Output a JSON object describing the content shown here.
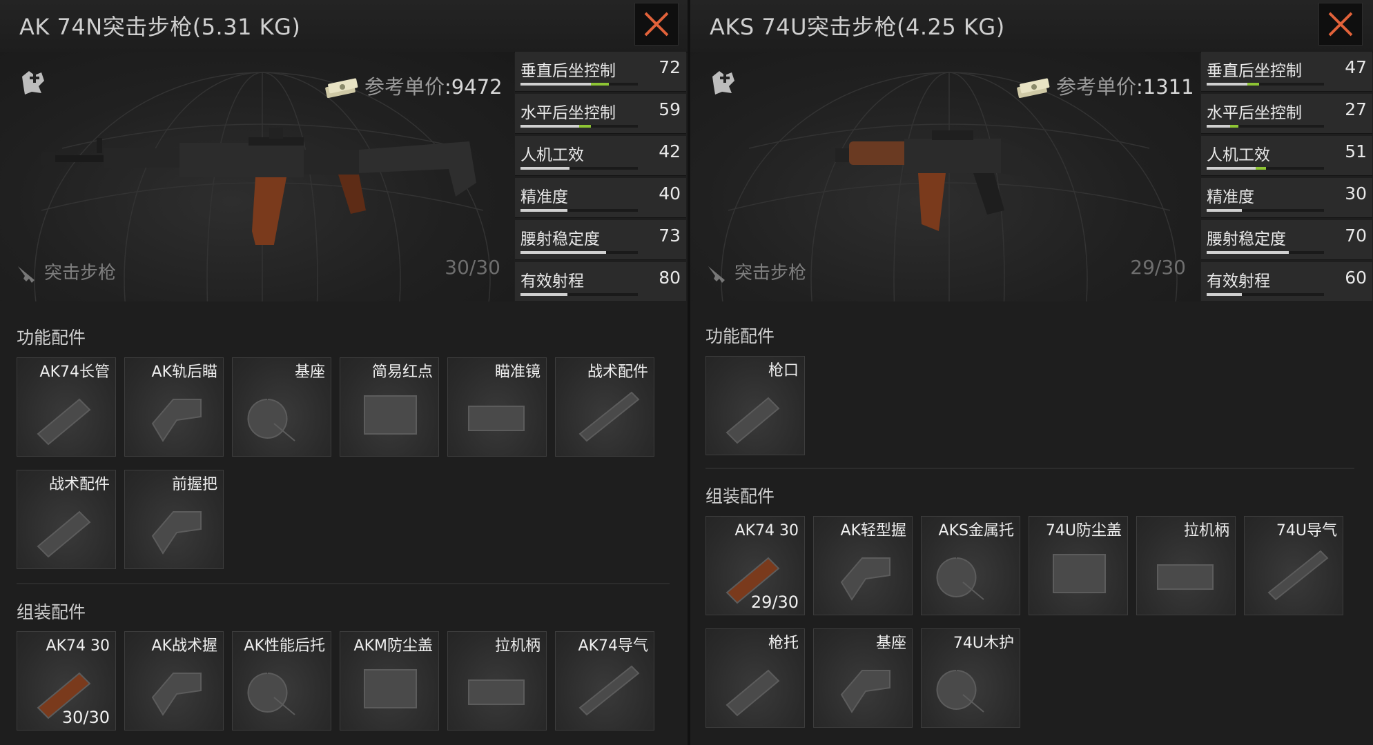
{
  "left": {
    "title": "AK 74N突击步枪(5.31 KG)",
    "price_label": "参考单价",
    "price_value": ":9472",
    "weapon_type": "突击步枪",
    "ammo": "30/30",
    "stats": [
      {
        "label": "垂直后坐控制",
        "value": "72",
        "fill": 0.6,
        "accent": 0.75
      },
      {
        "label": "水平后坐控制",
        "value": "59",
        "fill": 0.5,
        "accent": 0.6
      },
      {
        "label": "人机工效",
        "value": "42",
        "fill": 0.42,
        "accent": 0
      },
      {
        "label": "精准度",
        "value": "40",
        "fill": 0.4,
        "accent": 0
      },
      {
        "label": "腰射稳定度",
        "value": "73",
        "fill": 0.73,
        "accent": 0
      },
      {
        "label": "有效射程",
        "value": "80",
        "fill": 0.4,
        "accent": 0
      }
    ],
    "functional_title": "功能配件",
    "functional": [
      "AK74长管",
      "AK轨后瞄",
      "基座",
      "简易红点",
      "瞄准镜",
      "战术配件",
      "战术配件",
      "前握把"
    ],
    "assembly_title": "组装配件",
    "assembly": [
      {
        "label": "AK74 30",
        "ammo": "30/30"
      },
      {
        "label": "AK战术握",
        "ammo": ""
      },
      {
        "label": "AK性能后托",
        "ammo": ""
      },
      {
        "label": "AKM防尘盖",
        "ammo": ""
      },
      {
        "label": "拉机柄",
        "ammo": ""
      },
      {
        "label": "AK74导气",
        "ammo": ""
      }
    ]
  },
  "right": {
    "title": "AKS 74U突击步枪(4.25 KG)",
    "price_label": "参考单价",
    "price_value": ":1311",
    "weapon_type": "突击步枪",
    "ammo": "29/30",
    "stats": [
      {
        "label": "垂直后坐控制",
        "value": "47",
        "fill": 0.35,
        "accent": 0.45
      },
      {
        "label": "水平后坐控制",
        "value": "27",
        "fill": 0.2,
        "accent": 0.27
      },
      {
        "label": "人机工效",
        "value": "51",
        "fill": 0.42,
        "accent": 0.51
      },
      {
        "label": "精准度",
        "value": "30",
        "fill": 0.3,
        "accent": 0
      },
      {
        "label": "腰射稳定度",
        "value": "70",
        "fill": 0.7,
        "accent": 0
      },
      {
        "label": "有效射程",
        "value": "60",
        "fill": 0.3,
        "accent": 0
      }
    ],
    "functional_title": "功能配件",
    "functional": [
      "枪口"
    ],
    "assembly_title": "组装配件",
    "assembly": [
      {
        "label": "AK74 30",
        "ammo": "29/30"
      },
      {
        "label": "AK轻型握",
        "ammo": ""
      },
      {
        "label": "AKS金属托",
        "ammo": ""
      },
      {
        "label": "74U防尘盖",
        "ammo": ""
      },
      {
        "label": "拉机柄",
        "ammo": ""
      },
      {
        "label": "74U导气",
        "ammo": ""
      },
      {
        "label": "枪托",
        "ammo": ""
      },
      {
        "label": "基座",
        "ammo": ""
      },
      {
        "label": "74U木护",
        "ammo": ""
      }
    ]
  },
  "colors": {
    "accent_green": "#8ec534",
    "close_orange": "#e2623a",
    "wood": "#7a3a1c"
  },
  "icons": [
    "attachment-add-icon",
    "cash-icon",
    "rifle-icon",
    "close-icon"
  ]
}
